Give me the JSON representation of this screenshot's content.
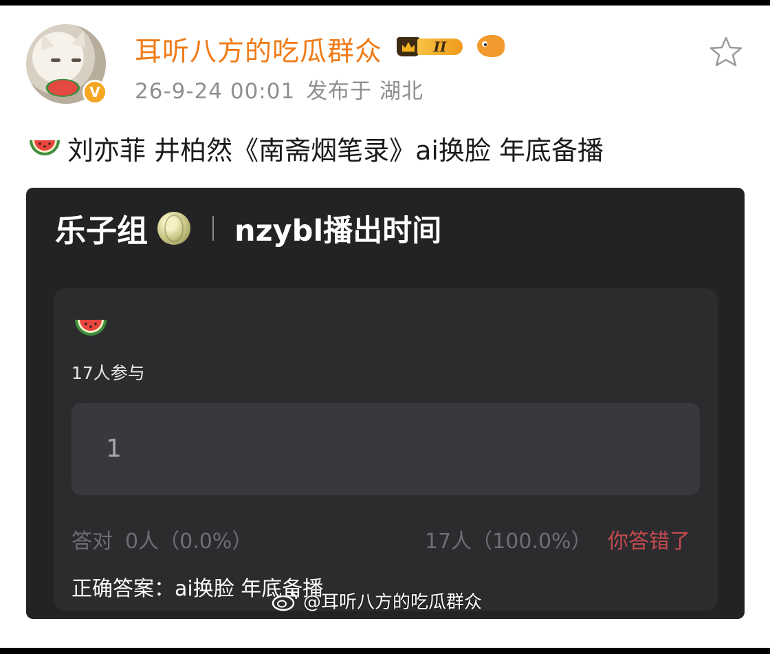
{
  "post": {
    "username": "耳听八方的吃瓜群众",
    "vip_level": "II",
    "timestamp": "26-9-24 00:01",
    "location": "发布于 湖北",
    "text": "刘亦菲 井柏然《南斋烟笔录》ai换脸 年底备播",
    "icons": {
      "avatar": "cat-eating-watermelon-avatar",
      "verified": "verified-badge-icon",
      "vip": "vip-crown-icon",
      "fish": "fish-icon",
      "favorite": "star-icon",
      "text_emoji": "watermelon-icon"
    },
    "colors": {
      "username": "#f07b17",
      "verified": "#f5a623",
      "wrong": "#c44a4f"
    }
  },
  "poll_card": {
    "group_name": "乐子组",
    "title": "nzybl播出时间",
    "participants": "17人参与",
    "options": [
      {
        "label": "1"
      }
    ],
    "correct_stats_label": "答对",
    "correct_stats_value": "0人（0.0%）",
    "option_stats": "17人（100.0%）",
    "result": "你答错了",
    "answer": "正确答案：ai换脸 年底备播",
    "icons": {
      "group": "melon-icon",
      "poll": "watermelon-icon"
    }
  },
  "watermark": {
    "text": "@耳听八方的吃瓜群众",
    "icon": "weibo-icon"
  }
}
